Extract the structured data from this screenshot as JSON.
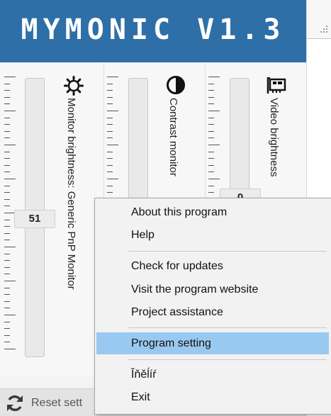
{
  "app": {
    "title": "MYMONIC V1.3"
  },
  "sliders": [
    {
      "label": "Monitor brightness: Generic PnP Monitor",
      "value": "51",
      "icon": "sun-icon"
    },
    {
      "label": "Contrast monitor",
      "value": "",
      "icon": "contrast-icon"
    },
    {
      "label": "Video brightness",
      "value": "0",
      "icon": "video-card-icon"
    }
  ],
  "footer": {
    "reset_label": "Reset sett"
  },
  "menu": {
    "items": [
      {
        "label": "About this program"
      },
      {
        "label": "Help"
      },
      {
        "label": "Check for updates"
      },
      {
        "label": "Visit the program website"
      },
      {
        "label": "Project assistance"
      },
      {
        "label": "Program setting",
        "highlighted": true
      },
      {
        "label": "Ĭňěĺíŕ"
      },
      {
        "label": "Exit"
      }
    ]
  },
  "colors": {
    "banner": "#2f6fa7",
    "menu_highlight": "#99c9f0"
  }
}
